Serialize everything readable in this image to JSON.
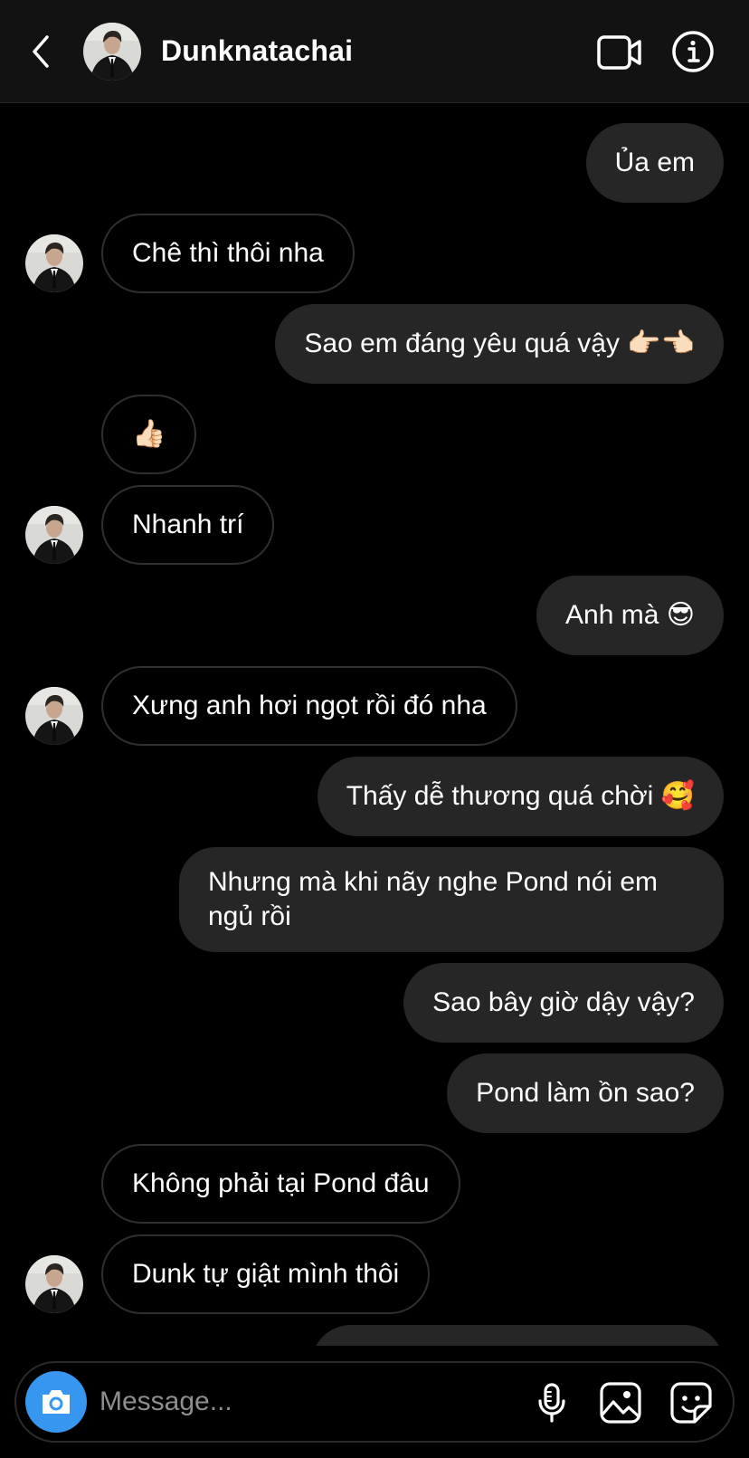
{
  "header": {
    "contact_name": "Dunknatachai",
    "back_icon": "chevron-left-icon",
    "video_icon": "video-camera-icon",
    "info_icon": "info-icon"
  },
  "messages": [
    {
      "dir": "out",
      "text": "Ủa em"
    },
    {
      "dir": "in",
      "text": "Chê thì thôi nha"
    },
    {
      "dir": "out",
      "text": "Sao em đáng yêu quá vậy 👉🏻👈🏻"
    },
    {
      "dir": "in",
      "text": "👍🏻"
    },
    {
      "dir": "in",
      "text": "Nhanh trí"
    },
    {
      "dir": "out",
      "text": "Anh mà 😎"
    },
    {
      "dir": "in",
      "text": "Xưng anh hơi ngọt rồi đó nha"
    },
    {
      "dir": "out",
      "text": "Thấy dễ thương quá chời 🥰"
    },
    {
      "dir": "out",
      "text": "Nhưng mà khi nãy nghe Pond nói em ngủ rồi"
    },
    {
      "dir": "out",
      "text": "Sao bây giờ dậy vậy?"
    },
    {
      "dir": "out",
      "text": "Pond làm ồn sao?"
    },
    {
      "dir": "in",
      "text": "Không phải tại Pond đâu"
    },
    {
      "dir": "in",
      "text": "Dunk tự giật mình thôi"
    }
  ],
  "composer": {
    "placeholder": "Message...",
    "camera_icon": "camera-icon",
    "mic_icon": "microphone-icon",
    "gallery_icon": "image-gallery-icon",
    "sticker_icon": "sticker-icon"
  },
  "colors": {
    "background": "#000000",
    "outgoing_bubble": "#262626",
    "incoming_border": "#2f2f2f",
    "camera_button": "#3797f0"
  }
}
